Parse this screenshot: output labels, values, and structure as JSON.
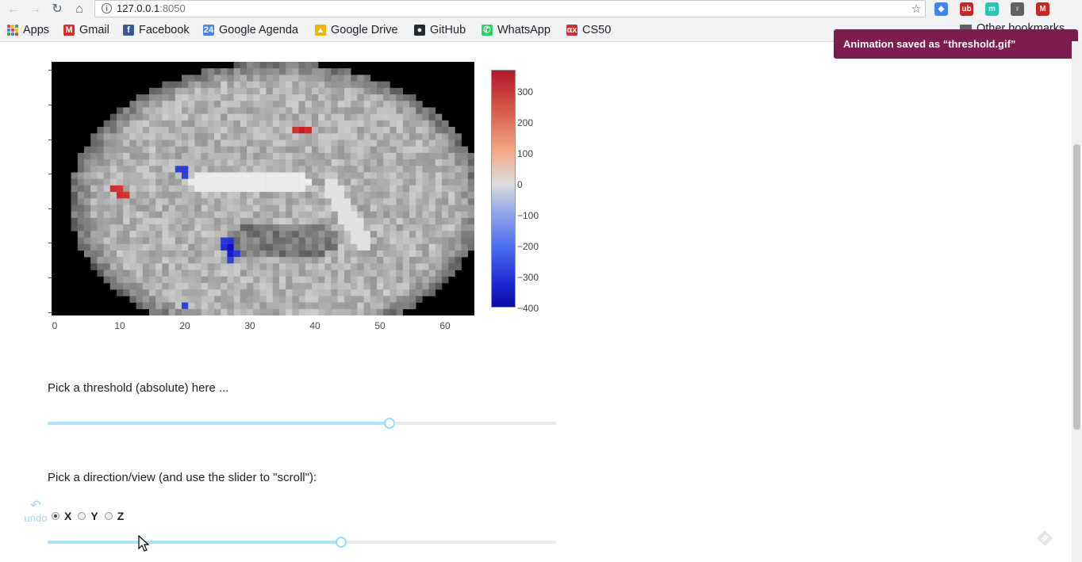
{
  "browser": {
    "url_host": "127.0.0.1",
    "url_port": ":8050",
    "star_icon": "star-icon",
    "extensions": [
      {
        "name": "ext-diamond-icon",
        "color": "#4285f4",
        "glyph": "◆"
      },
      {
        "name": "ext-ublock-icon",
        "color": "#c62828",
        "glyph": "ub"
      },
      {
        "name": "ext-mi-icon",
        "color": "#26c6b0",
        "glyph": "m"
      },
      {
        "name": "ext-bulb-icon",
        "color": "#616161",
        "glyph": "♀"
      },
      {
        "name": "ext-mail-icon",
        "color": "#c62828",
        "glyph": "M"
      }
    ]
  },
  "bookmarks": [
    {
      "label": "Apps",
      "icon": "apps-grid-icon"
    },
    {
      "label": "Gmail",
      "icon": "gmail-icon",
      "glyph": "M",
      "color": "#d93025"
    },
    {
      "label": "Facebook",
      "icon": "facebook-icon",
      "glyph": "f",
      "color": "#3b5998"
    },
    {
      "label": "Google Agenda",
      "icon": "calendar-icon",
      "glyph": "24",
      "color": "#4285f4"
    },
    {
      "label": "Google Drive",
      "icon": "drive-icon",
      "glyph": "▲",
      "color": "#f4b400"
    },
    {
      "label": "GitHub",
      "icon": "github-icon",
      "glyph": "●",
      "color": "#24292e"
    },
    {
      "label": "WhatsApp",
      "icon": "whatsapp-icon",
      "glyph": "✆",
      "color": "#25d366"
    },
    {
      "label": "CS50",
      "icon": "cs50-icon",
      "glyph": "αx",
      "color": "#d32f2f"
    }
  ],
  "other_bookmarks": "Other bookmarks",
  "toast": {
    "text": "Animation saved as “threshold.gif”"
  },
  "heatmap": {
    "x_ticks": [
      "0",
      "10",
      "20",
      "30",
      "40",
      "50",
      "60"
    ],
    "colorbar_ticks": [
      "300",
      "200",
      "100",
      "0",
      "−100",
      "−200",
      "−300",
      "−400"
    ],
    "hot_voxels": [
      {
        "x": 37,
        "y": 10,
        "v": 220
      },
      {
        "x": 38,
        "y": 10,
        "v": 330
      },
      {
        "x": 39,
        "y": 10,
        "v": 260
      },
      {
        "x": 9,
        "y": 19,
        "v": 230
      },
      {
        "x": 10,
        "y": 19,
        "v": 210
      },
      {
        "x": 10,
        "y": 20,
        "v": 230
      },
      {
        "x": 11,
        "y": 20,
        "v": 220
      },
      {
        "x": 19,
        "y": 16,
        "v": -160
      },
      {
        "x": 20,
        "y": 16,
        "v": -180
      },
      {
        "x": 20,
        "y": 17,
        "v": -150
      },
      {
        "x": 26,
        "y": 27,
        "v": -200
      },
      {
        "x": 27,
        "y": 27,
        "v": -220
      },
      {
        "x": 26,
        "y": 28,
        "v": -250
      },
      {
        "x": 27,
        "y": 28,
        "v": -380
      },
      {
        "x": 27,
        "y": 29,
        "v": -320
      },
      {
        "x": 28,
        "y": 29,
        "v": -200
      },
      {
        "x": 27,
        "y": 30,
        "v": -150
      },
      {
        "x": 20,
        "y": 37,
        "v": -170
      }
    ]
  },
  "threshold": {
    "label": "Pick a threshold (absolute) here ...",
    "value_fraction": 0.672
  },
  "direction": {
    "label": "Pick a direction/view (and use the slider to \"scroll\"):",
    "options": [
      "X",
      "Y",
      "Z"
    ],
    "selected": "X",
    "slice_fraction": 0.577
  },
  "undo": {
    "label": "undo",
    "icon": "undo-icon"
  }
}
